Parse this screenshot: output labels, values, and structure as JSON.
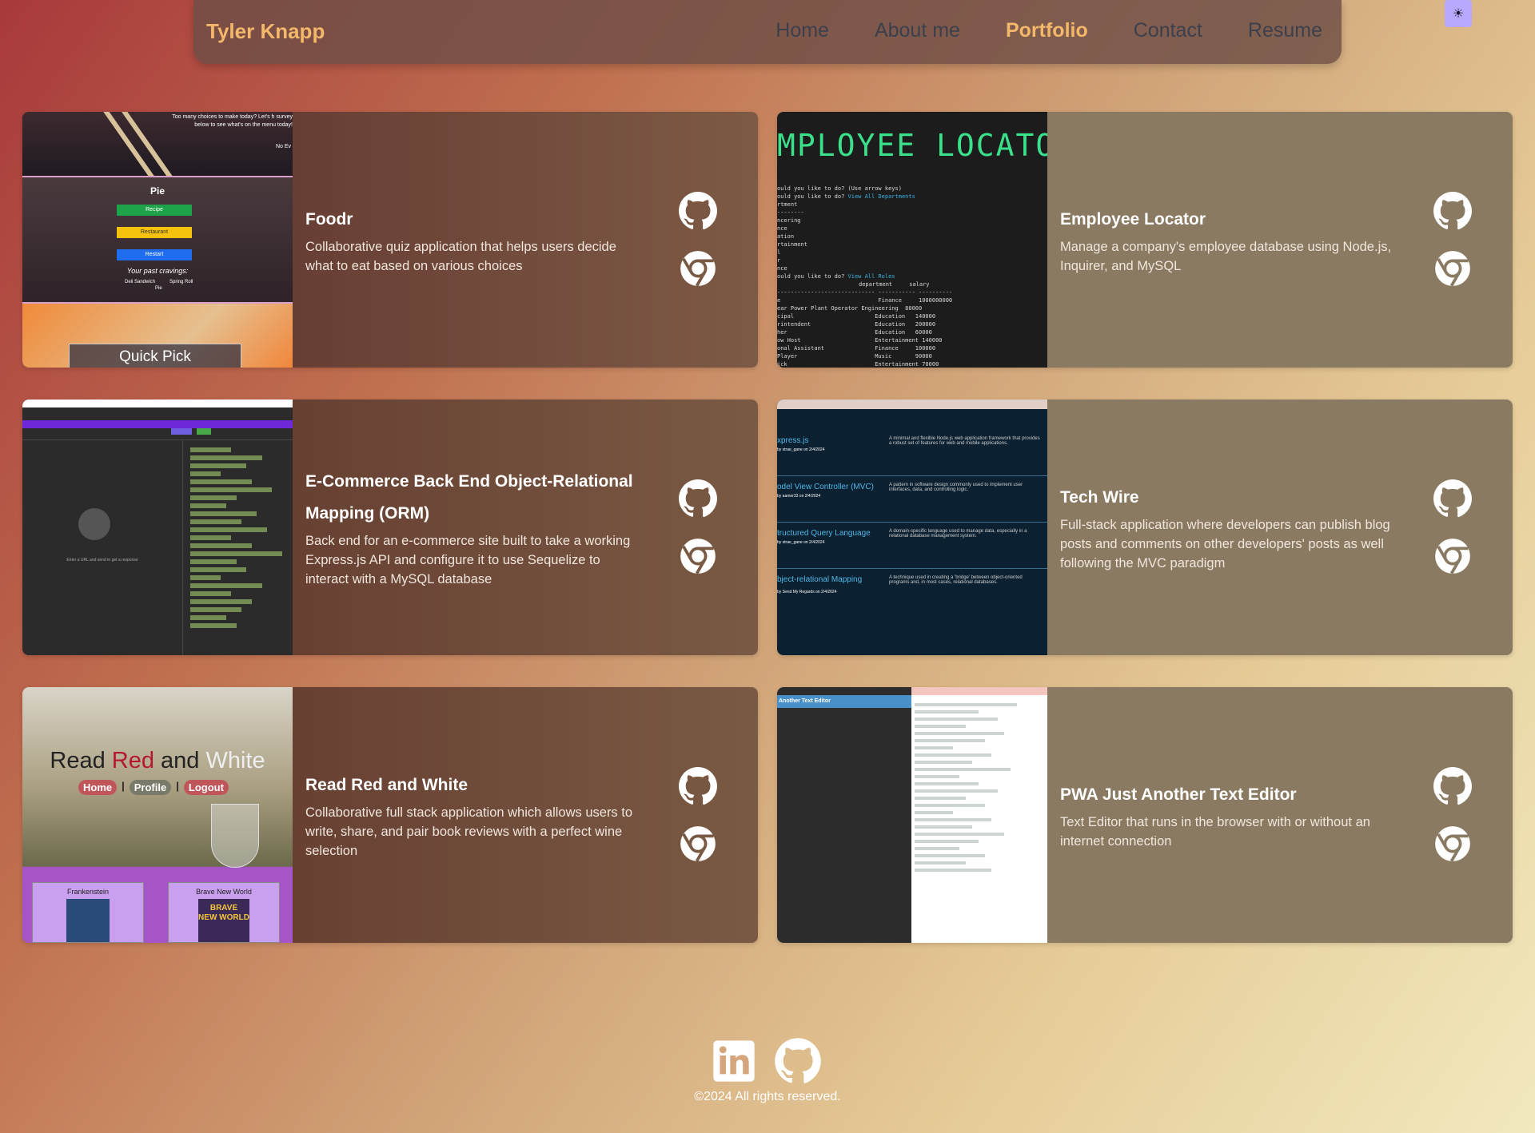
{
  "nav": {
    "brand": "Tyler Knapp",
    "links": [
      {
        "label": "Home"
      },
      {
        "label": "About me"
      },
      {
        "label": "Portfolio"
      },
      {
        "label": "Contact"
      },
      {
        "label": "Resume"
      }
    ],
    "active": "Portfolio",
    "theme_toggle_icon": "sun-icon"
  },
  "projects": [
    {
      "title": "Foodr",
      "description": "Collaborative quiz application that helps users decide what to eat based on various choices",
      "thumb": {
        "top_text": "Too many choices to make today? Let's h survey below to see what's on the menu today!",
        "corner": "No Ev",
        "heading": "Pie",
        "buttons": [
          "Recipe",
          "Restaurant",
          "Restart"
        ],
        "cravings": "Your past cravings:",
        "items": [
          "Deli Sandwich",
          "Spring Roll",
          "Pie"
        ],
        "cta": "Quick Pick"
      }
    },
    {
      "title": "Employee Locator",
      "description": "Manage a company's employee database using Node.js, Inquirer, and MySQL",
      "thumb": {
        "banner": "MPLOYEE LOCATOR",
        "prompt1": "ould you like to do? (Use arrow keys)",
        "prompt2": "ould you like to do?",
        "answer2": "View All Departments",
        "prompt3": "ould you like to do?",
        "answer3": "View All Roles",
        "header_cols": [
          "department",
          "salary"
        ]
      }
    },
    {
      "title": "E-Commerce Back End Object-Relational Mapping (ORM)",
      "description": "Back end for an e-commerce site built to take a working Express.js API and configure it to use Sequelize to interact with a MySQL database",
      "thumb": {
        "empty_hint": "Enter a URL and send to get a response"
      }
    },
    {
      "title": "Tech Wire",
      "description": "Full-stack application where developers can publish blog posts and comments on other developers' posts as well following the MVC paradigm",
      "thumb": {
        "posts": [
          {
            "title": "xpress.js",
            "by": "by strae_gane on 2/4/2024",
            "desc": "A minimal and flexible Node.js web application framework that provides a robust set of features for web and mobile applications."
          },
          {
            "title": "odel View Controller (MVC)",
            "by": "by aamer33 on 2/4/2024",
            "desc": "A pattern in software design commonly used to implement user interfaces, data, and controlling logic."
          },
          {
            "title": "tructured Query Language",
            "by": "by strae_gane on 2/4/2024",
            "desc": "A domain-specific language used to manage data, especially in a relational database management system."
          },
          {
            "title": "bject-relational Mapping",
            "by": "by Send My Regards on 2/4/2024",
            "desc": "A technique used in creating a 'bridge' between object-oriented programs and, in most cases, relational databases."
          }
        ]
      }
    },
    {
      "title": "Read Red and White",
      "description": "Collaborative full stack application which allows users to write, share, and pair book reviews with a perfect wine selection",
      "thumb": {
        "title_parts": [
          "Read ",
          "Red",
          " and ",
          "White"
        ],
        "nav": [
          "Home",
          "Profile",
          "Logout"
        ],
        "books": [
          "Frankenstein",
          "Brave New World"
        ]
      }
    },
    {
      "title": "PWA Just Another Text Editor",
      "description": "Text Editor that runs in the browser with or without an internet connection",
      "thumb": {
        "app_bar": "Another Text Editor"
      }
    }
  ],
  "footer": {
    "icons": [
      "linkedin-icon",
      "github-icon"
    ],
    "copyright": "©2024 All rights reserved."
  },
  "colors": {
    "accent": "#f4b86b",
    "nav_link": "#3c3f4c",
    "theme_toggle": "#b8a9ff"
  }
}
